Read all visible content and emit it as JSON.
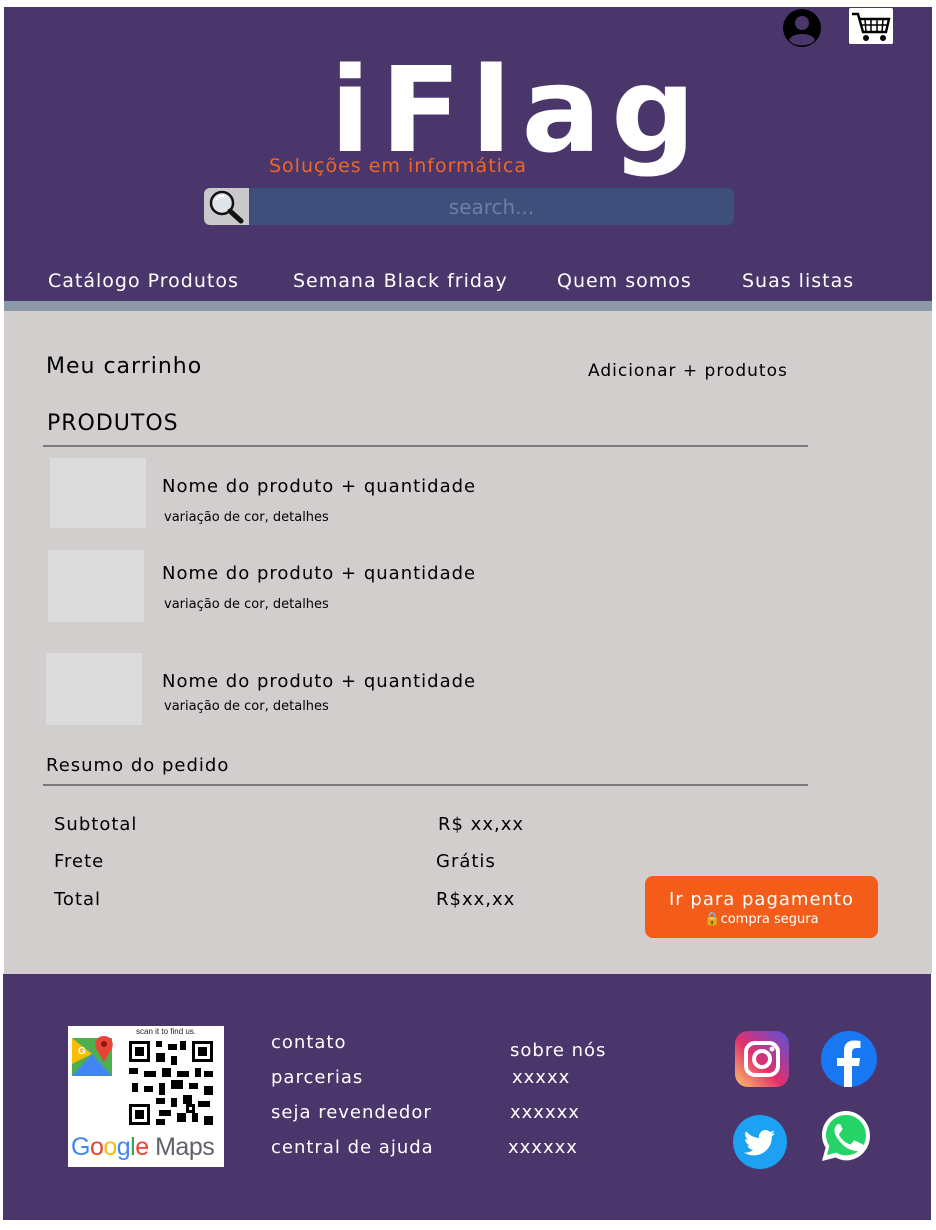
{
  "header": {
    "logo": "iFlag",
    "tagline": "Soluções em informática",
    "search_placeholder": "search...",
    "icons": {
      "account": "user-circle-icon",
      "cart": "shopping-cart-icon",
      "search": "magnifier-icon"
    },
    "nav": [
      "Catálogo Produtos",
      "Semana Black friday",
      "Quem somos",
      "Suas listas"
    ]
  },
  "cart": {
    "title": "Meu carrinho",
    "add_more": "Adicionar + produtos",
    "products_heading": "PRODUTOS",
    "items": [
      {
        "name": "Nome do produto + quantidade",
        "detail": "variação de cor, detalhes"
      },
      {
        "name": "Nome do produto + quantidade",
        "detail": "variação de cor, detalhes"
      },
      {
        "name": "Nome do produto + quantidade",
        "detail": "variação de cor, detalhes"
      }
    ],
    "summary": {
      "heading": "Resumo do pedido",
      "subtotal_label": "Subtotal",
      "subtotal_value": "R$ xx,xx",
      "shipping_label": "Frete",
      "shipping_value": "Grátis",
      "total_label": "Total",
      "total_value": "R$xx,xx"
    },
    "checkout": {
      "label": "Ir para pagamento",
      "sub": "compra segura"
    }
  },
  "footer": {
    "qr": {
      "scan_text": "scan it to find us.",
      "maps_brand": "Google Maps",
      "maps_google": "Google",
      "maps_word": "Maps"
    },
    "links_col1": [
      "contato",
      "parcerias",
      "seja revendedor",
      "central de ajuda"
    ],
    "links_col2": [
      "sobre nós",
      "xxxxx",
      "xxxxxx",
      "xxxxxx"
    ],
    "social": [
      "instagram-icon",
      "facebook-icon",
      "twitter-icon",
      "whatsapp-icon"
    ]
  },
  "colors": {
    "header_bg": "#4a366b",
    "accent_orange": "#f26522",
    "content_bg": "#d1cecd",
    "checkout_bg": "#f45c1a"
  }
}
